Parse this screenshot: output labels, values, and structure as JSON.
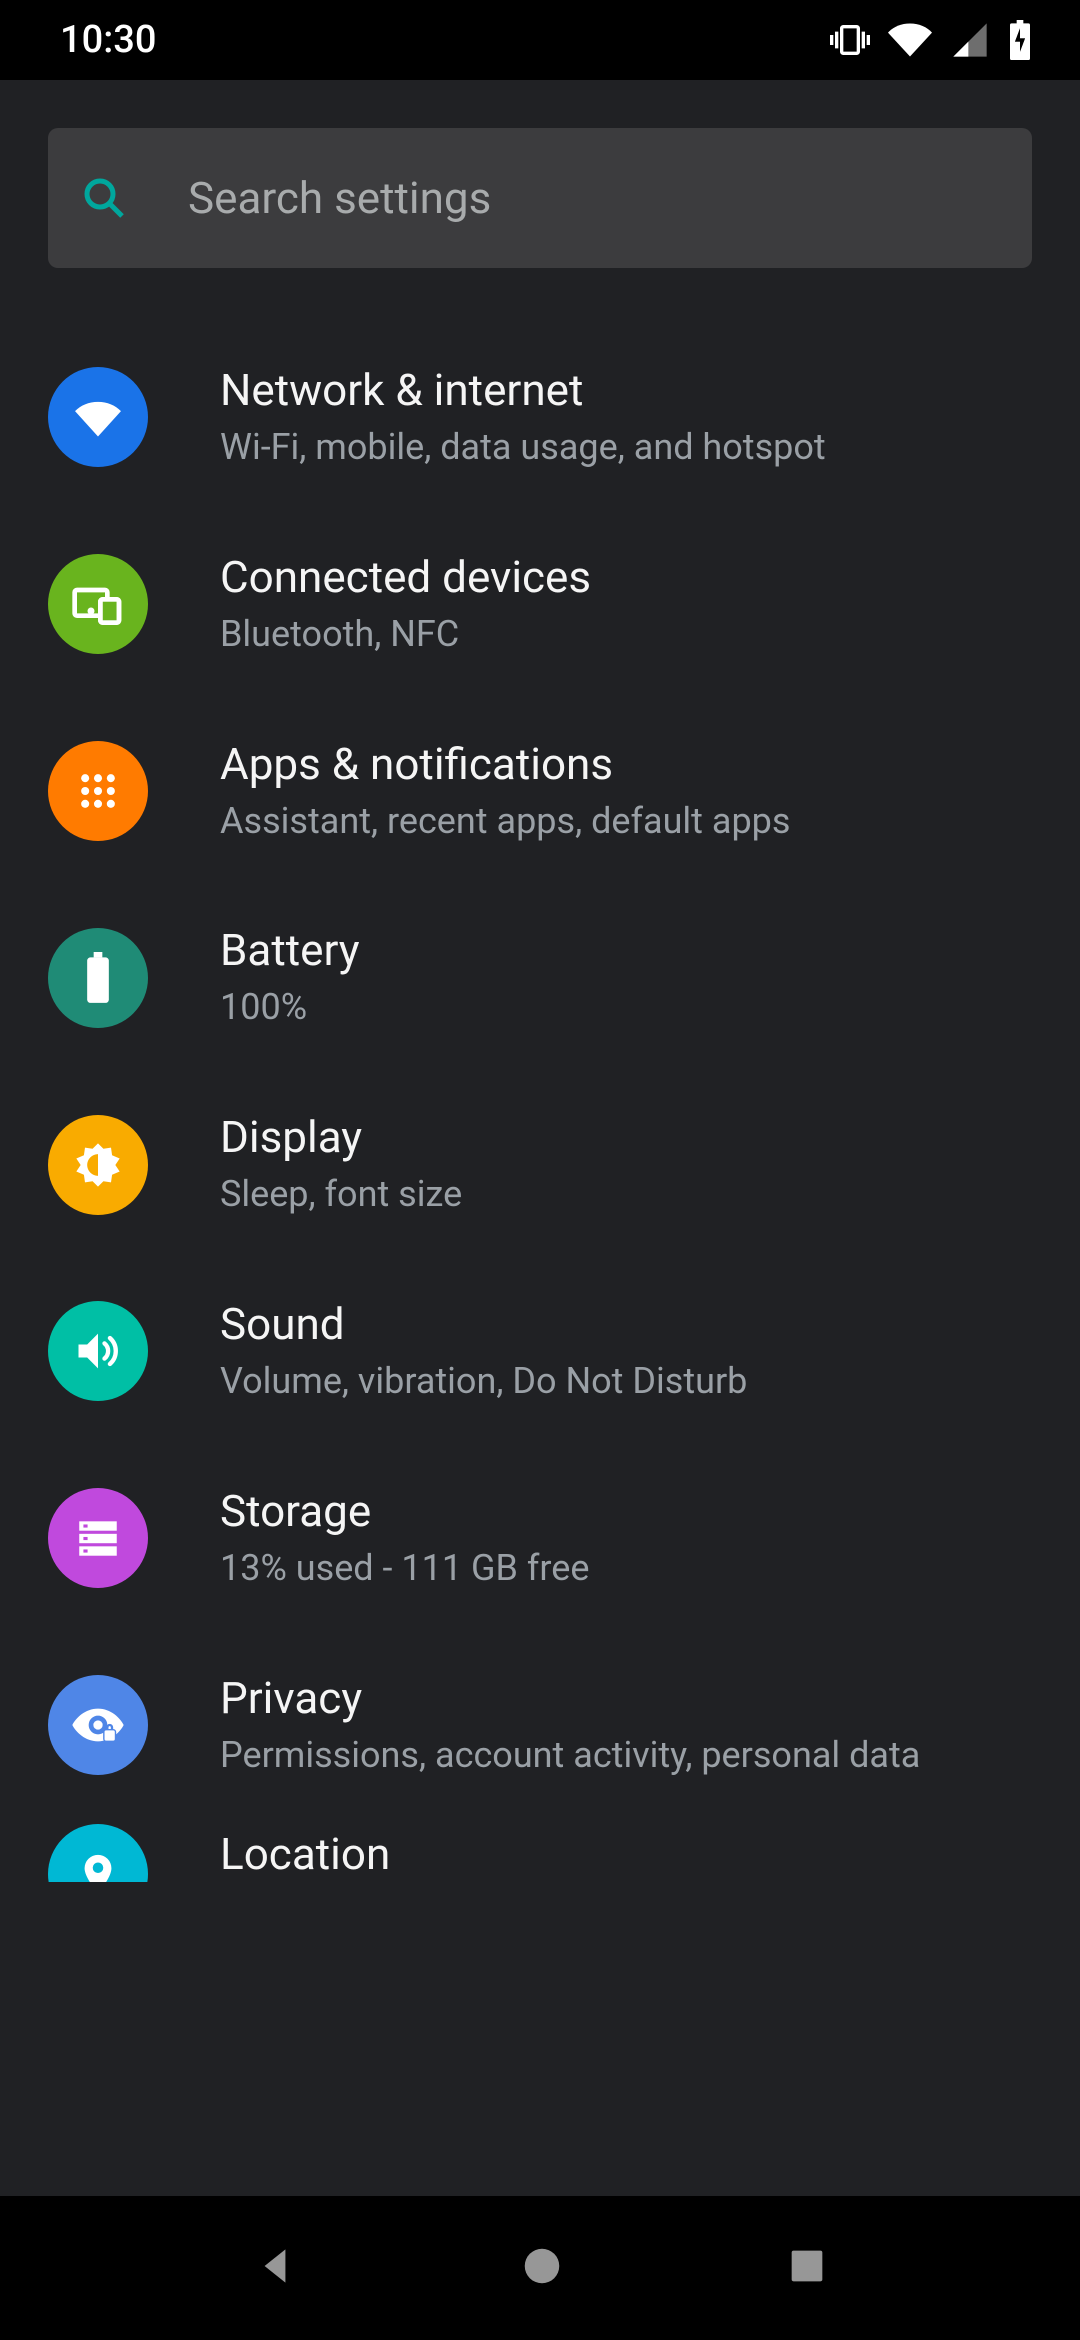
{
  "status_bar": {
    "time": "10:30"
  },
  "search": {
    "placeholder": "Search settings"
  },
  "items": [
    {
      "title": "Network & internet",
      "subtitle": "Wi-Fi, mobile, data usage, and hotspot"
    },
    {
      "title": "Connected devices",
      "subtitle": "Bluetooth, NFC"
    },
    {
      "title": "Apps & notifications",
      "subtitle": "Assistant, recent apps, default apps"
    },
    {
      "title": "Battery",
      "subtitle": "100%"
    },
    {
      "title": "Display",
      "subtitle": "Sleep, font size"
    },
    {
      "title": "Sound",
      "subtitle": "Volume, vibration, Do Not Disturb"
    },
    {
      "title": "Storage",
      "subtitle": "13% used - 111 GB free"
    },
    {
      "title": "Privacy",
      "subtitle": "Permissions, account activity, personal data"
    },
    {
      "title": "Location",
      "subtitle": ""
    }
  ],
  "colors": {
    "network": "#1a73e8",
    "connected": "#69b41e",
    "apps": "#ff7b00",
    "battery": "#1f8b76",
    "display": "#f9ab00",
    "sound": "#00bfa5",
    "storage": "#c049dd",
    "privacy": "#4f86e7",
    "location": "#00b8d4"
  }
}
